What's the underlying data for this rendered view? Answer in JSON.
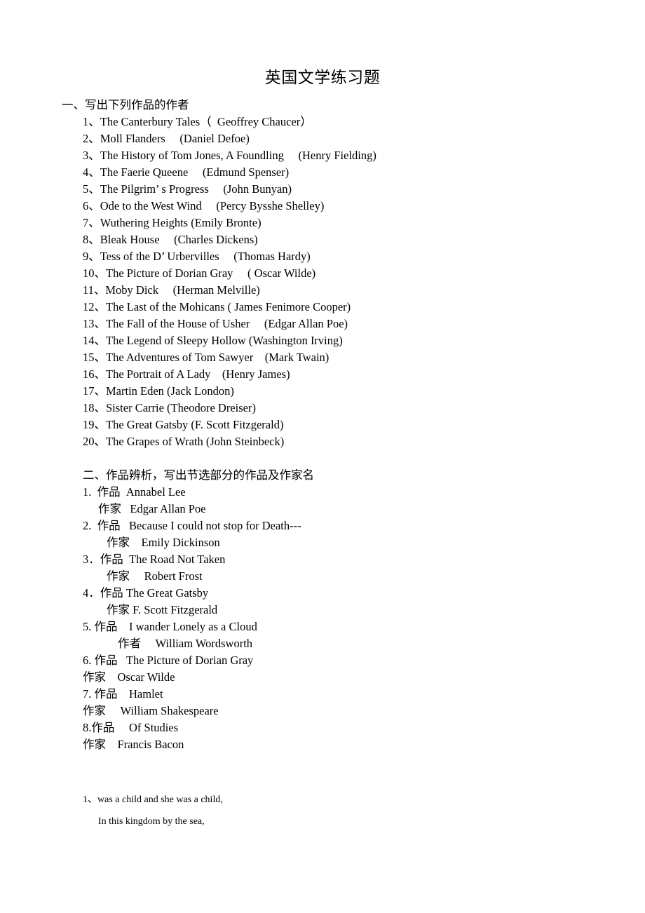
{
  "document": {
    "title": "英国文学练习题",
    "background_color": "#ffffff",
    "text_color": "#000000"
  },
  "section_one": {
    "heading": "一、写出下列作品的作者",
    "items": [
      "1、The Canterbury Tales（  Geoffrey Chaucer）",
      "2、Moll Flanders     (Daniel Defoe)",
      "3、The History of Tom Jones, A Foundling     (Henry Fielding)",
      "4、The Faerie Queene     (Edmund Spenser)",
      "5、The Pilgrim’ s Progress     (John Bunyan)",
      "6、Ode to the West Wind     (Percy Bysshe Shelley)",
      "7、Wuthering Heights (Emily Bronte)",
      "8、Bleak House     (Charles Dickens)",
      "9、Tess of the D’ Urbervilles     (Thomas Hardy)",
      "10、The Picture of Dorian Gray     ( Oscar Wilde)",
      "11、Moby Dick     (Herman Melville)",
      "12、The Last of the Mohicans ( James Fenimore Cooper)",
      "13、The Fall of the House of Usher     (Edgar Allan Poe)",
      "14、The Legend of Sleepy Hollow (Washington Irving)",
      "15、The Adventures of Tom Sawyer    (Mark Twain)",
      "16、The Portrait of A Lady    (Henry James)",
      "17、Martin Eden (Jack London)",
      "18、Sister Carrie (Theodore Dreiser)",
      "19、The Great Gatsby (F. Scott Fitzgerald)",
      "20、The Grapes of Wrath (John Steinbeck)"
    ]
  },
  "section_two": {
    "heading": "二、作品辨析，写出节选部分的作品及作家名",
    "entries": [
      {
        "work_line": "1.  作品  Annabel Lee",
        "author_line": "作家   Edgar Allan Poe"
      },
      {
        "work_line": "2.  作品   Because I could not stop for Death---",
        "author_line": "作家    Emily Dickinson"
      },
      {
        "work_line": "3．作品  The Road Not Taken",
        "author_line": "作家     Robert Frost"
      },
      {
        "work_line": "4．作品 The Great Gatsby",
        "author_line": "作家 F. Scott Fitzgerald"
      },
      {
        "work_line": "5. 作品    I wander Lonely as a Cloud",
        "author_line": "作者     William Wordsworth"
      },
      {
        "work_line": "6. 作品   The Picture of Dorian Gray",
        "author_line": "作家    Oscar Wilde"
      },
      {
        "work_line": "7. 作品    Hamlet",
        "author_line": "作家     William Shakespeare"
      },
      {
        "work_line": "8.作品     Of Studies",
        "author_line": "作家    Francis Bacon"
      }
    ]
  },
  "section_three": {
    "lines": [
      "1、was a child and she was a child,",
      "In this kingdom by the sea,"
    ]
  }
}
